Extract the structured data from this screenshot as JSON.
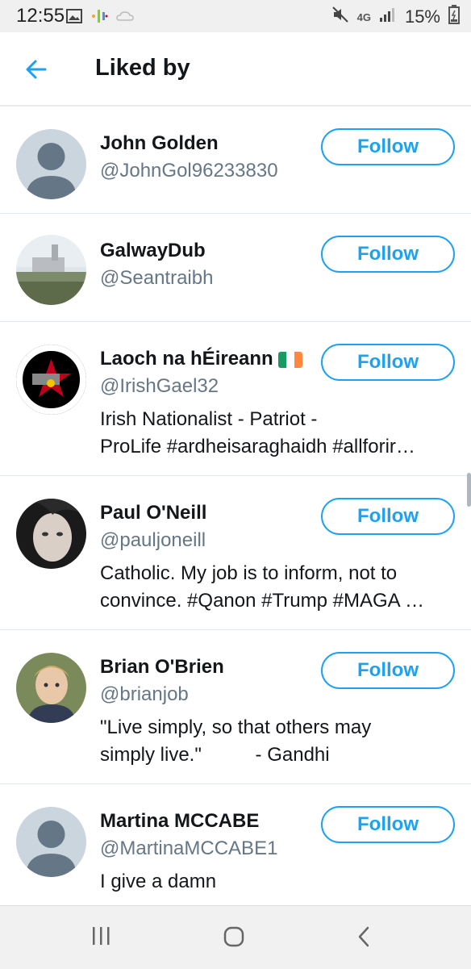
{
  "status_bar": {
    "time": "12:55",
    "network": "4G",
    "battery": "15%"
  },
  "header": {
    "title": "Liked by"
  },
  "follow_label": "Follow",
  "users": [
    {
      "name": "John Golden",
      "handle": "@JohnGol96233830",
      "bio": []
    },
    {
      "name": "GalwayDub",
      "handle": "@Seantraibh",
      "bio": []
    },
    {
      "name": "Laoch na hÉireann",
      "handle": "@IrishGael32",
      "bio": [
        "Irish Nationalist - Patriot -",
        "ProLife #ardheisaraghaidh #allforir…"
      ],
      "avatar_text": "SMASH THE RED SCUM"
    },
    {
      "name": "Paul O'Neill",
      "handle": "@pauljoneill",
      "bio": [
        "Catholic. My job is to inform, not to",
        "convince. #Qanon #Trump #MAGA …"
      ]
    },
    {
      "name": "Brian O'Brien",
      "handle": "@brianjob",
      "bio": [
        "\"Live simply, so that others may",
        "simply live.\"          - Gandhi"
      ]
    },
    {
      "name": "Martina MCCABE",
      "handle": "@MartinaMCCABE1",
      "bio": [
        "I give a damn"
      ]
    }
  ],
  "colors": {
    "accent": "#1da1f2",
    "secondary_text": "#657786",
    "divider": "#e1e8ed"
  },
  "icons": [
    "image-icon",
    "podcast-icon",
    "mute-icon",
    "signal-icon",
    "battery-icon",
    "back-arrow-icon",
    "recent-apps-icon",
    "home-icon",
    "back-nav-icon"
  ]
}
